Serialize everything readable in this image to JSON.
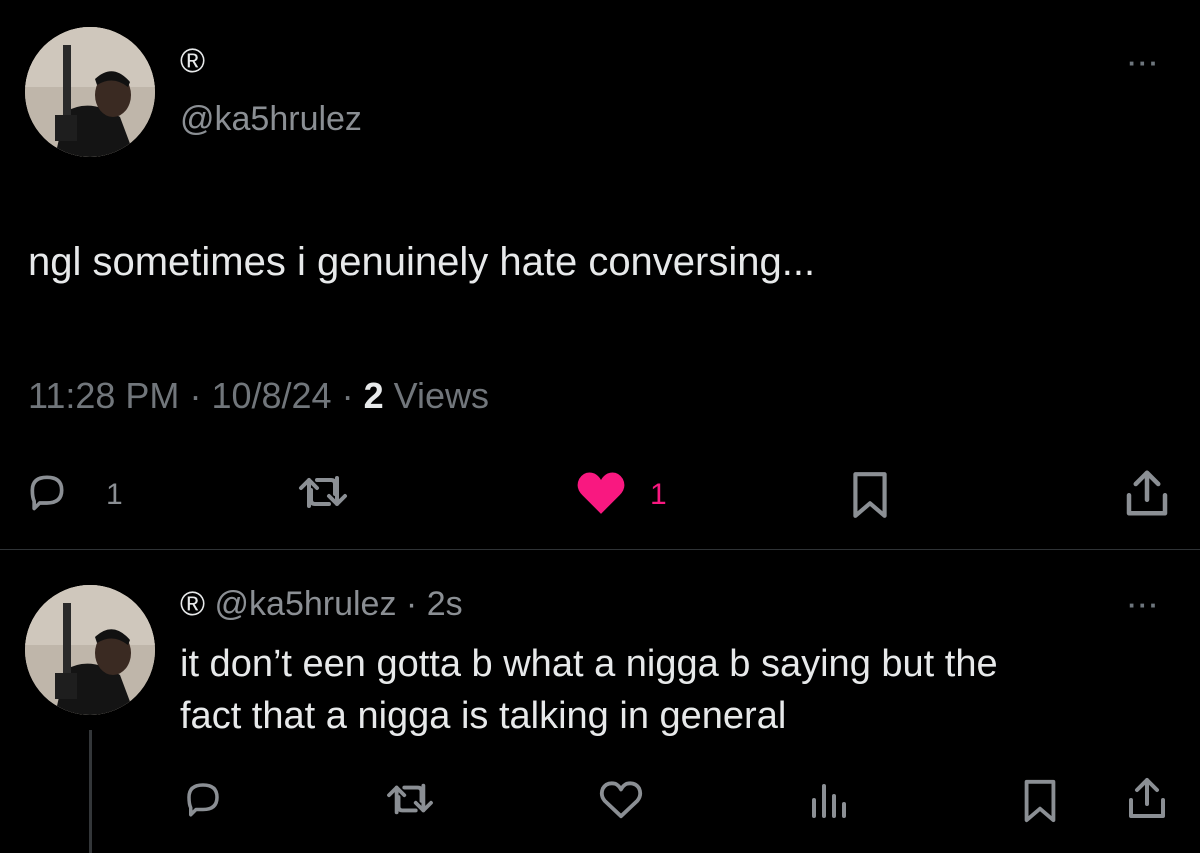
{
  "main_tweet": {
    "display_name": "®",
    "handle": "@ka5hrulez",
    "more": "···",
    "text": "ngl sometimes i genuinely hate conversing...",
    "time": "11:28 PM",
    "date": "10/8/24",
    "views_count": "2",
    "views_label": "Views",
    "sep": "·",
    "actions": {
      "reply_count": "1",
      "retweet_count": "",
      "like_count": "1",
      "like_color": "#f91880"
    }
  },
  "reply_tweet": {
    "display_name": "®",
    "handle": "@ka5hrulez",
    "sep": "·",
    "age": "2s",
    "more": "···",
    "text_line1": "it don’t een gotta b what a nigga b saying but the",
    "text_line2": "fact that a nigga is talking in general"
  },
  "icons": {
    "reply": "reply-icon",
    "retweet": "retweet-icon",
    "like": "heart-icon",
    "bookmark": "bookmark-icon",
    "share": "share-icon",
    "analytics": "analytics-icon"
  }
}
